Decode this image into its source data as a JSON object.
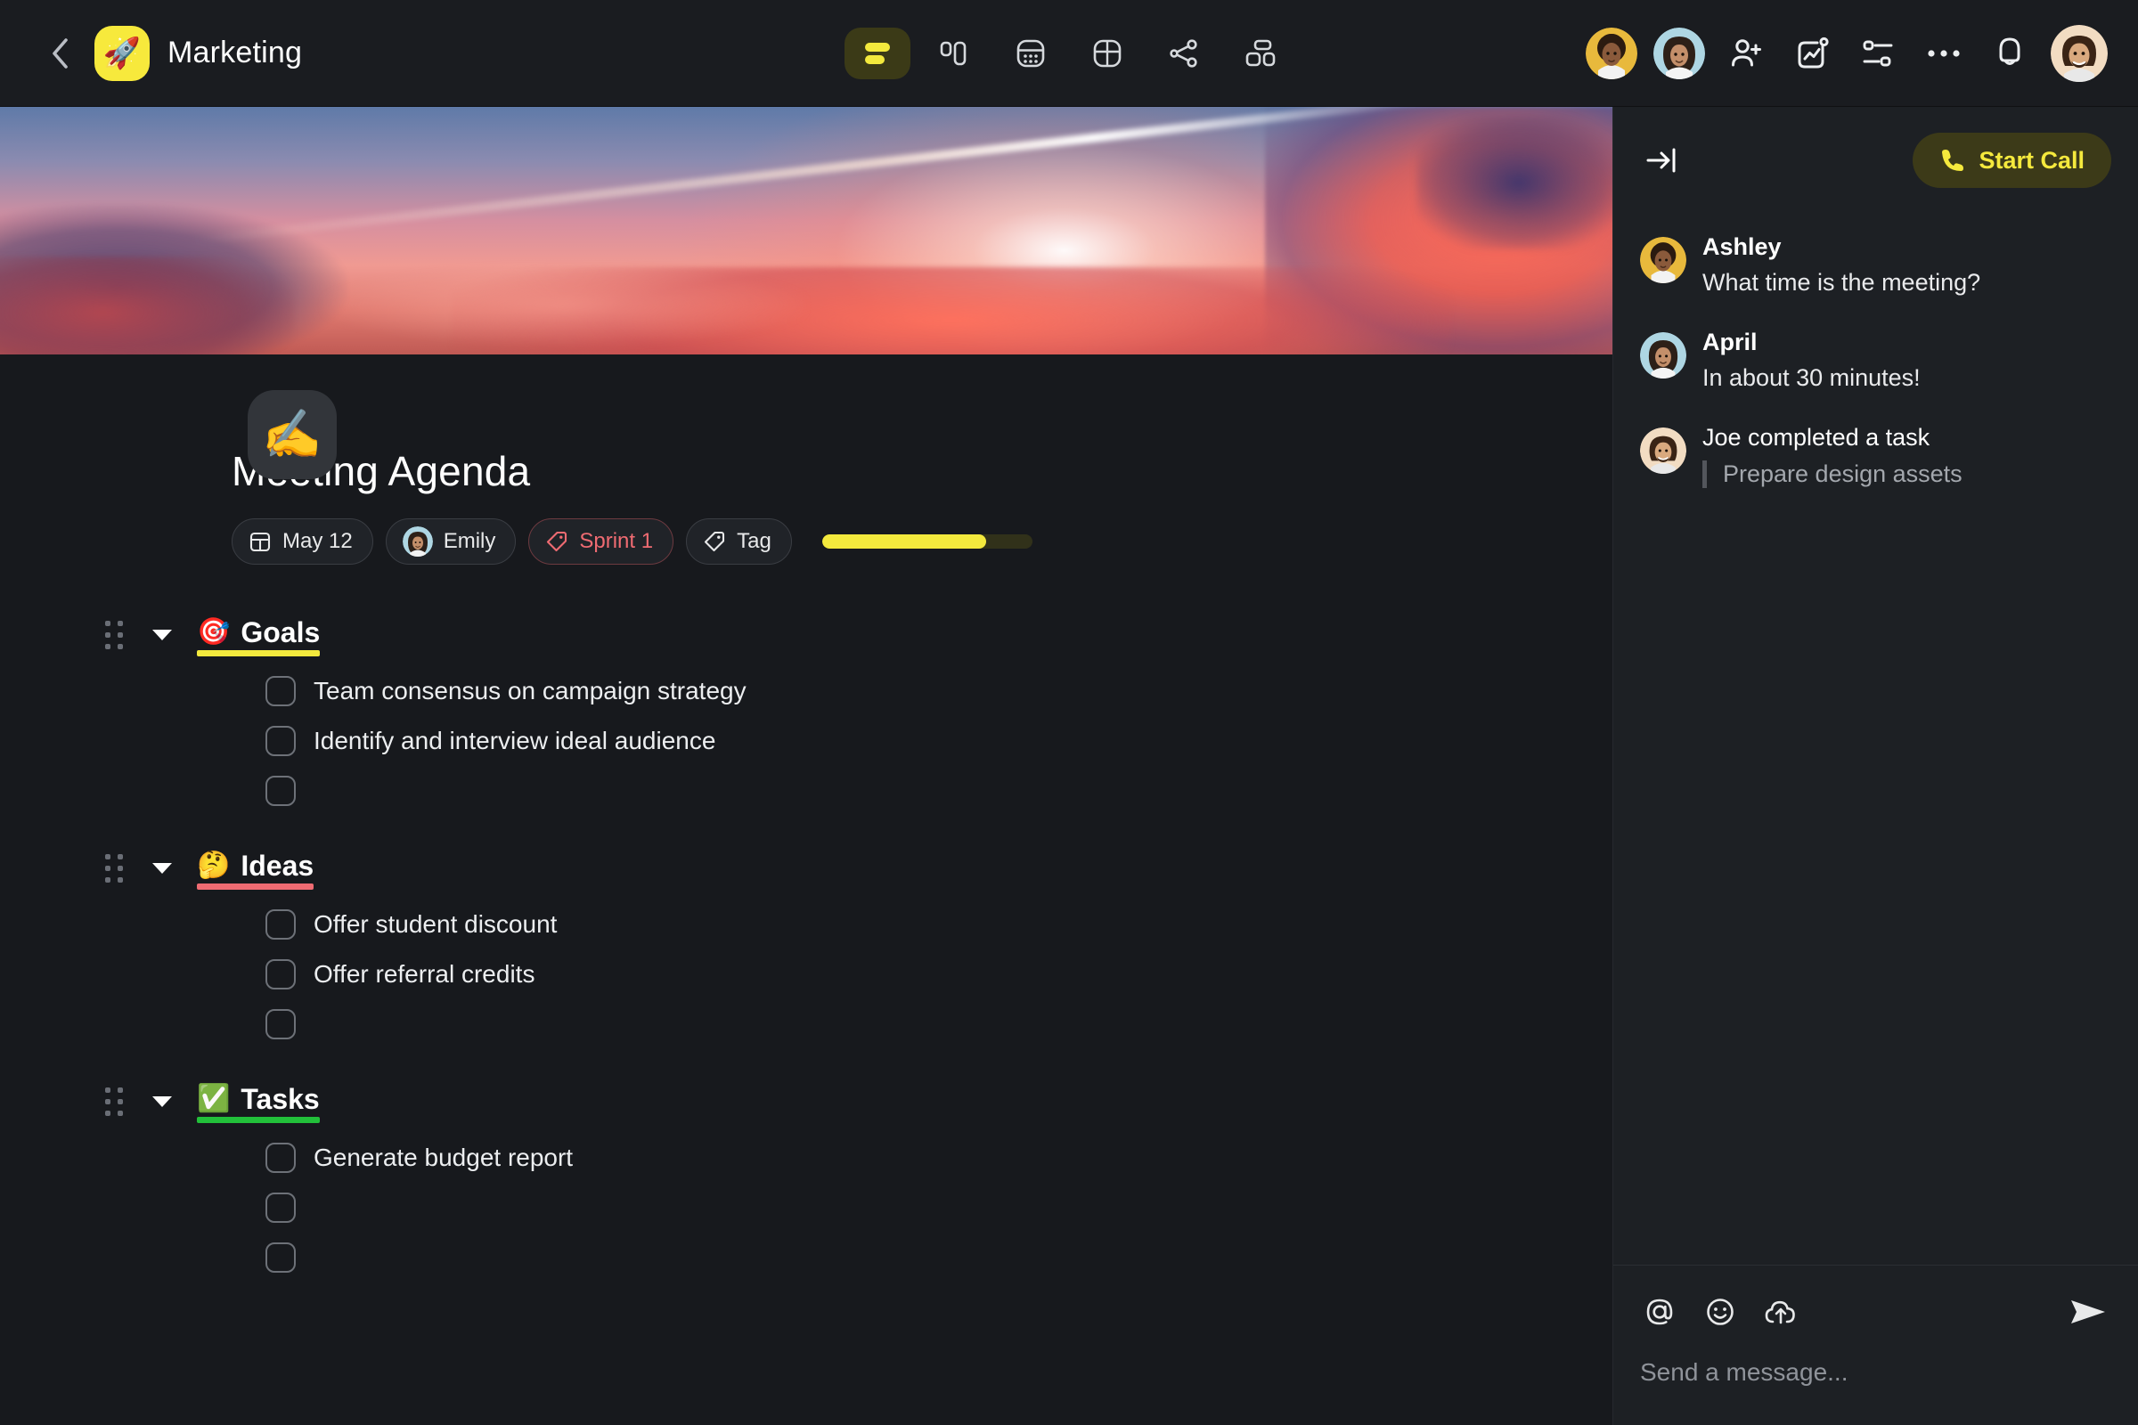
{
  "topbar": {
    "back_icon": "chevron-left-icon",
    "space_emoji": "🚀",
    "space_name": "Marketing",
    "views": [
      {
        "name": "list-view",
        "icon": "list-view-icon",
        "active": true
      },
      {
        "name": "board-view",
        "icon": "columns-icon",
        "active": false
      },
      {
        "name": "calendar-view",
        "icon": "calendar-dots-icon",
        "active": false
      },
      {
        "name": "table-view",
        "icon": "table-icon",
        "active": false
      },
      {
        "name": "graph-view",
        "icon": "share-nodes-icon",
        "active": false
      },
      {
        "name": "dashboard-view",
        "icon": "dashboard-blocks-icon",
        "active": false
      }
    ],
    "right_actions": [
      {
        "name": "member-avatar-ashley",
        "icon": "avatar"
      },
      {
        "name": "member-avatar-april",
        "icon": "avatar"
      },
      {
        "name": "invite-member-button",
        "icon": "user-plus-icon"
      },
      {
        "name": "activity-button",
        "icon": "activity-chart-icon"
      },
      {
        "name": "filter-button",
        "icon": "sliders-icon"
      },
      {
        "name": "more-options-button",
        "icon": "ellipsis-icon"
      },
      {
        "name": "notifications-button",
        "icon": "bell-icon"
      },
      {
        "name": "account-avatar",
        "icon": "avatar"
      }
    ]
  },
  "document": {
    "icon_emoji": "✍️",
    "title": "Meeting Agenda",
    "chips": [
      {
        "name": "date-chip",
        "icon": "calendar-icon",
        "label": "May 12",
        "style": "default"
      },
      {
        "name": "assignee-chip",
        "icon": "avatar",
        "label": "Emily",
        "style": "default"
      },
      {
        "name": "sprint-chip",
        "icon": "tag-icon",
        "label": "Sprint 1",
        "style": "accent"
      },
      {
        "name": "tag-chip",
        "icon": "tag-icon",
        "label": "Tag",
        "style": "default"
      }
    ],
    "progress": {
      "name": "progress-bar",
      "percent": 78,
      "fill_color": "#f3e93d",
      "track_color": "#31311a"
    },
    "sections": [
      {
        "name": "goals",
        "emoji": "🎯",
        "title": "Goals",
        "underline_color": "#f3e93d",
        "items": [
          {
            "label": "Team consensus on campaign strategy",
            "checked": false
          },
          {
            "label": "Identify and interview ideal audience",
            "checked": false
          },
          {
            "label": "",
            "checked": false
          }
        ]
      },
      {
        "name": "ideas",
        "emoji": "🤔",
        "title": "Ideas",
        "underline_color": "#ef6b72",
        "items": [
          {
            "label": "Offer student discount",
            "checked": false
          },
          {
            "label": "Offer referral credits",
            "checked": false
          },
          {
            "label": "",
            "checked": false
          }
        ]
      },
      {
        "name": "tasks",
        "emoji": "✅",
        "title": "Tasks",
        "underline_color": "#22c03a",
        "items": [
          {
            "label": "Generate budget report",
            "checked": false
          },
          {
            "label": "",
            "checked": false
          },
          {
            "label": "",
            "checked": false
          }
        ]
      }
    ]
  },
  "chat": {
    "collapse_icon": "collapse-panel-right-icon",
    "start_call": {
      "label": "Start Call",
      "icon": "phone-icon",
      "text_color": "#f5e93d",
      "bg_color": "#3c3a18"
    },
    "messages": [
      {
        "name": "Ashley",
        "text": "What time is the meeting?",
        "type": "message"
      },
      {
        "name": "April",
        "text": "In about 30 minutes!",
        "type": "message"
      },
      {
        "name": "Joe",
        "text": "Joe completed a task",
        "quote": "Prepare design assets",
        "type": "activity"
      }
    ],
    "composer": {
      "placeholder": "Send a message...",
      "value": "",
      "icons": [
        {
          "name": "mention-icon",
          "glyph": "@"
        },
        {
          "name": "emoji-icon",
          "glyph": "smile"
        },
        {
          "name": "upload-icon",
          "glyph": "cloud-up"
        }
      ],
      "send_icon": "send-icon"
    }
  },
  "theme": {
    "bg": "#17191d",
    "topbar_bg": "#1a1c20",
    "panel_bg": "#1d2024",
    "accent_yellow": "#f3e93d",
    "accent_red": "#ef6b72",
    "accent_green": "#22c03a"
  }
}
